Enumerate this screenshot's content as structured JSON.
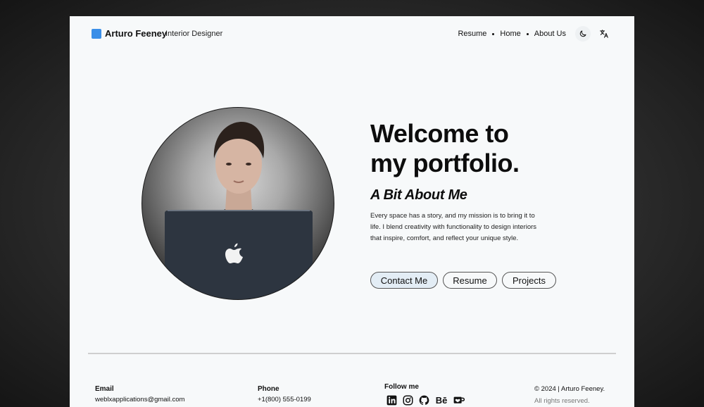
{
  "header": {
    "brand_name": "Arturo Feeney",
    "brand_role": "Interior Designer",
    "nav": [
      {
        "label": "Resume"
      },
      {
        "label": "Home"
      },
      {
        "label": "About Us"
      }
    ],
    "theme_icon": "moon-icon",
    "language_icon": "translate-icon",
    "accent_color": "#3b8fe8"
  },
  "hero": {
    "title_line1": "Welcome to",
    "title_line2": "my portfolio.",
    "about_title": "A Bit About Me",
    "about_text": "Every space has a story, and my mission is to bring it to life. I blend creativity with functionality to design interiors that inspire, comfort, and reflect your unique style.",
    "buttons": {
      "contact": "Contact Me",
      "resume": "Resume",
      "projects": "Projects"
    }
  },
  "footer": {
    "email_label": "Email",
    "email_value": "weblxapplications@gmail.com",
    "phone_label": "Phone",
    "phone_value": "+1(800) 555-0199",
    "follow_label": "Follow me",
    "socials": [
      "linkedin-icon",
      "instagram-icon",
      "github-icon",
      "behance-icon",
      "coffee-icon"
    ],
    "behance_text": "Bē",
    "copyright": "© 2024 | Arturo Feeney.",
    "rights": "All rights reserved."
  }
}
